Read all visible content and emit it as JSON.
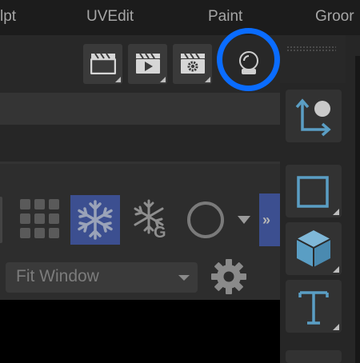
{
  "menu": {
    "items": [
      "lpt",
      "UVEdit",
      "Paint",
      "Groor"
    ]
  },
  "toolbar": {
    "buttons": [
      {
        "icon": "clapperboard-icon"
      },
      {
        "icon": "clapperboard-play-icon"
      },
      {
        "icon": "clapperboard-gear-icon"
      },
      {
        "icon": "crystal-ball-icon"
      }
    ]
  },
  "tools": [
    {
      "icon": "snap-to-point-icon"
    },
    {
      "icon": "rectangle-icon"
    },
    {
      "icon": "cube-icon"
    },
    {
      "icon": "text-tool-icon"
    }
  ],
  "panel": {
    "icons": [
      "grid-icon",
      "snowflake-icon",
      "snowflake-g-icon",
      "circle-icon",
      "dropdown-arrow-icon",
      "double-chevron-right-icon",
      "gear-icon"
    ],
    "expand_symbol": "»",
    "select": {
      "value": "Fit Window"
    }
  },
  "colors": {
    "highlight": "#0a6cff",
    "active_button": "#3c4f90",
    "cube": "#5a9ec4"
  }
}
